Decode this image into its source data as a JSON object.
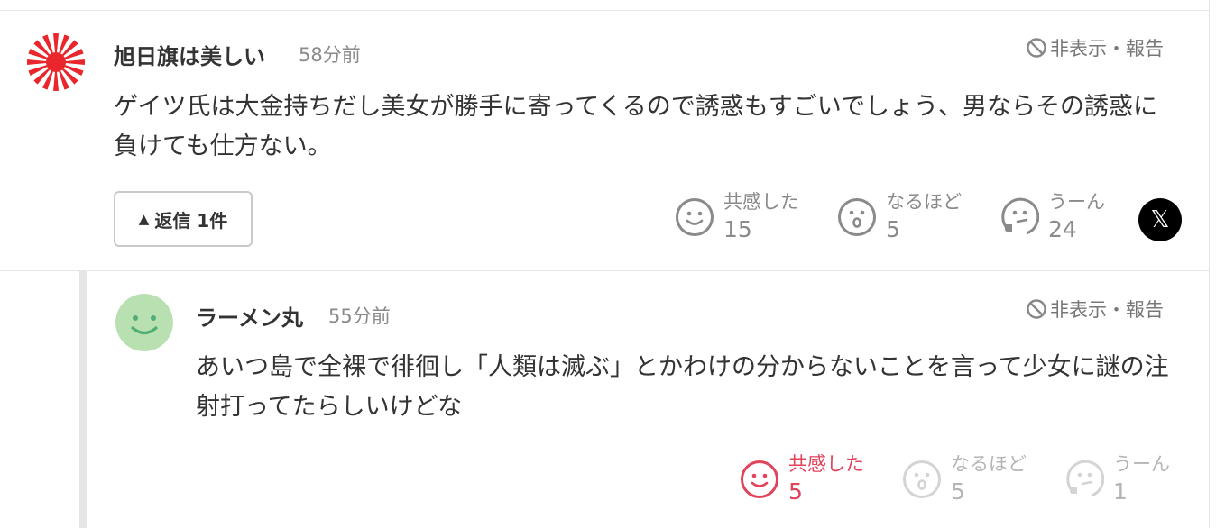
{
  "comments": [
    {
      "username": "旭日旗は美しい",
      "time": "58分前",
      "hide_report": "非表示・報告",
      "text": "ゲイツ氏は大金持ちだし美女が勝手に寄ってくるので誘惑もすごいでしょう、男ならその誘惑に負けても仕方ない。",
      "reply_button": "返信 1件",
      "reactions": [
        {
          "label": "共感した",
          "count": "15",
          "icon": "smile-icon"
        },
        {
          "label": "なるほど",
          "count": "5",
          "icon": "surprised-icon"
        },
        {
          "label": "うーん",
          "count": "24",
          "icon": "thinking-icon"
        }
      ],
      "share_icon": "x-logo-icon"
    },
    {
      "username": "ラーメン丸",
      "time": "55分前",
      "hide_report": "非表示・報告",
      "text": "あいつ島で全裸で徘徊し「人類は滅ぶ」とかわけの分からないことを言って少女に謎の注射打ってたらしいけどな",
      "reactions": [
        {
          "label": "共感した",
          "count": "5",
          "icon": "smile-icon",
          "state": "selected"
        },
        {
          "label": "なるほど",
          "count": "5",
          "icon": "surprised-icon"
        },
        {
          "label": "うーん",
          "count": "1",
          "icon": "thinking-icon"
        }
      ]
    }
  ],
  "colors": {
    "active_reaction": "#e0435a",
    "reaction_gray": "#8a8a8a",
    "muted_reaction": "#b5b5b5",
    "avatar_red": "#e8262b",
    "avatar_green": "#b8e0b0"
  }
}
